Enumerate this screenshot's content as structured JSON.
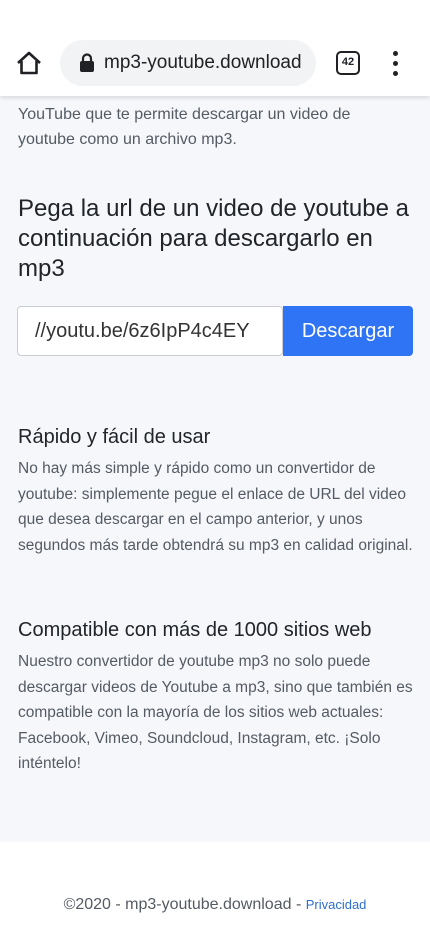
{
  "browser": {
    "url": "mp3-youtube.download",
    "tab_count": "42",
    "icons": [
      "home-icon",
      "lock-icon",
      "tab-switcher-icon",
      "overflow-menu-icon"
    ]
  },
  "intro": {
    "text": "YouTube que te permite descargar un video de youtube como un archivo mp3."
  },
  "converter": {
    "heading": "Pega la url de un video de youtube a continuación para descargarlo en mp3",
    "input_value": "//youtu.be/6z6IpP4c4EY",
    "button_label": "Descargar"
  },
  "features": [
    {
      "title": "Rápido y fácil de usar",
      "body": "No hay más simple y rápido como un convertidor de youtube: simplemente pegue el enlace de URL del video que desea descargar en el campo anterior, y unos segundos más tarde obtendrá su mp3 en calidad original."
    },
    {
      "title": "Compatible con más de 1000 sitios web",
      "body": "Nuestro convertidor de youtube mp3 no solo puede descargar videos de Youtube a mp3, sino que también es compatible con la mayoría de los sitios web actuales: Facebook, Vimeo, Soundcloud, Instagram, etc. ¡Solo inténtelo!"
    }
  ],
  "footer": {
    "copyright": "©2020 - mp3-youtube.download - ",
    "privacy_label": "Privacidad"
  },
  "colors": {
    "accent": "#2f74f5",
    "page_background": "#f5f7fb",
    "text": "#212529",
    "muted_text": "#555b63",
    "link": "#2f6fd0"
  }
}
